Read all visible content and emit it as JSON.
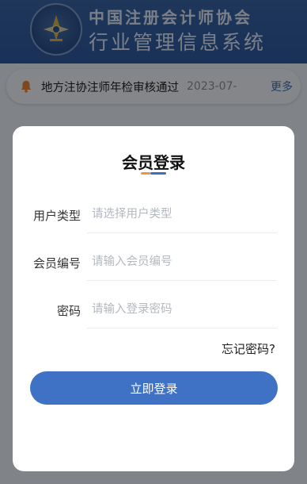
{
  "header": {
    "title_line1": "中国注册会计师协会",
    "title_line2": "行业管理信息系统"
  },
  "notice": {
    "text": "地方注协注师年检审核通过",
    "date": "2023-07-",
    "more_label": "更多"
  },
  "modal": {
    "title": "会员登录",
    "fields": [
      {
        "label": "用户类型",
        "placeholder": "请选择用户类型"
      },
      {
        "label": "会员编号",
        "placeholder": "请输入会员编号"
      },
      {
        "label": "密码",
        "placeholder": "请输入登录密码"
      }
    ],
    "forgot_label": "忘记密码?",
    "login_label": "立即登录"
  },
  "colors": {
    "accent": "#3f72c4",
    "underline_orange": "#e8964a"
  }
}
